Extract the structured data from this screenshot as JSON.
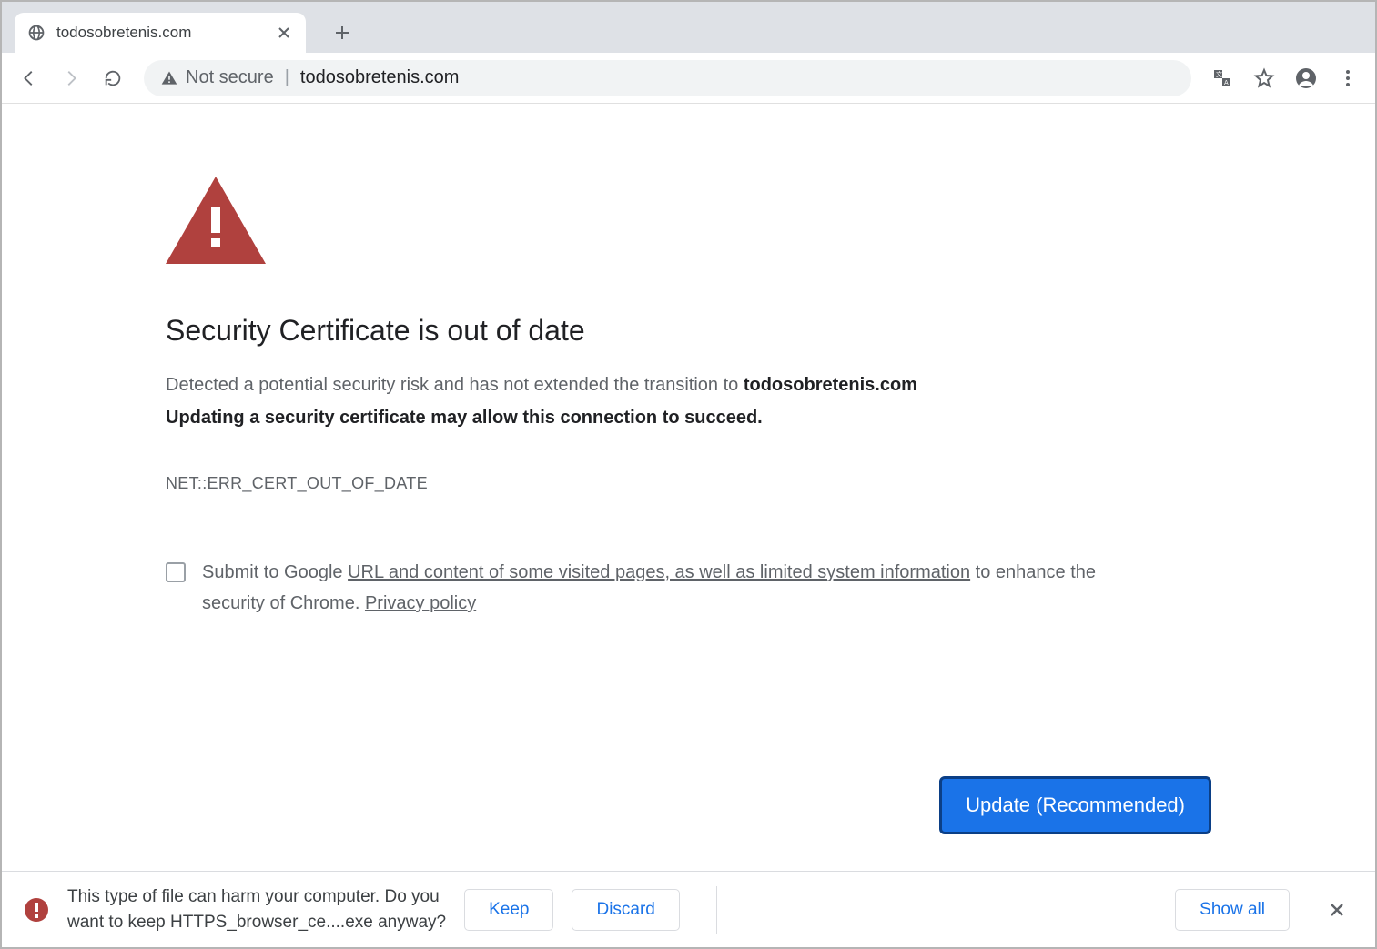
{
  "tab": {
    "title": "todosobretenis.com"
  },
  "omnibox": {
    "security_label": "Not secure",
    "url": "todosobretenis.com"
  },
  "page": {
    "title": "Security Certificate is out of date",
    "desc_prefix": "Detected a potential security risk and has not extended the transition to ",
    "desc_domain": "todosobretenis.com",
    "desc_bold": "Updating a security certificate may allow this connection to succeed.",
    "error_code": "NET::ERR_CERT_OUT_OF_DATE",
    "optin_prefix": "Submit to Google ",
    "optin_link": "URL and content of some visited pages, as well as limited system information",
    "optin_mid": " to enhance the security of Chrome. ",
    "optin_privacy": "Privacy policy",
    "update_button": "Update (Recommended)"
  },
  "download": {
    "warning_line1": "This type of file can harm your computer. Do you",
    "warning_line2": "want to keep HTTPS_browser_ce....exe anyway?",
    "keep": "Keep",
    "discard": "Discard",
    "show_all": "Show all"
  }
}
